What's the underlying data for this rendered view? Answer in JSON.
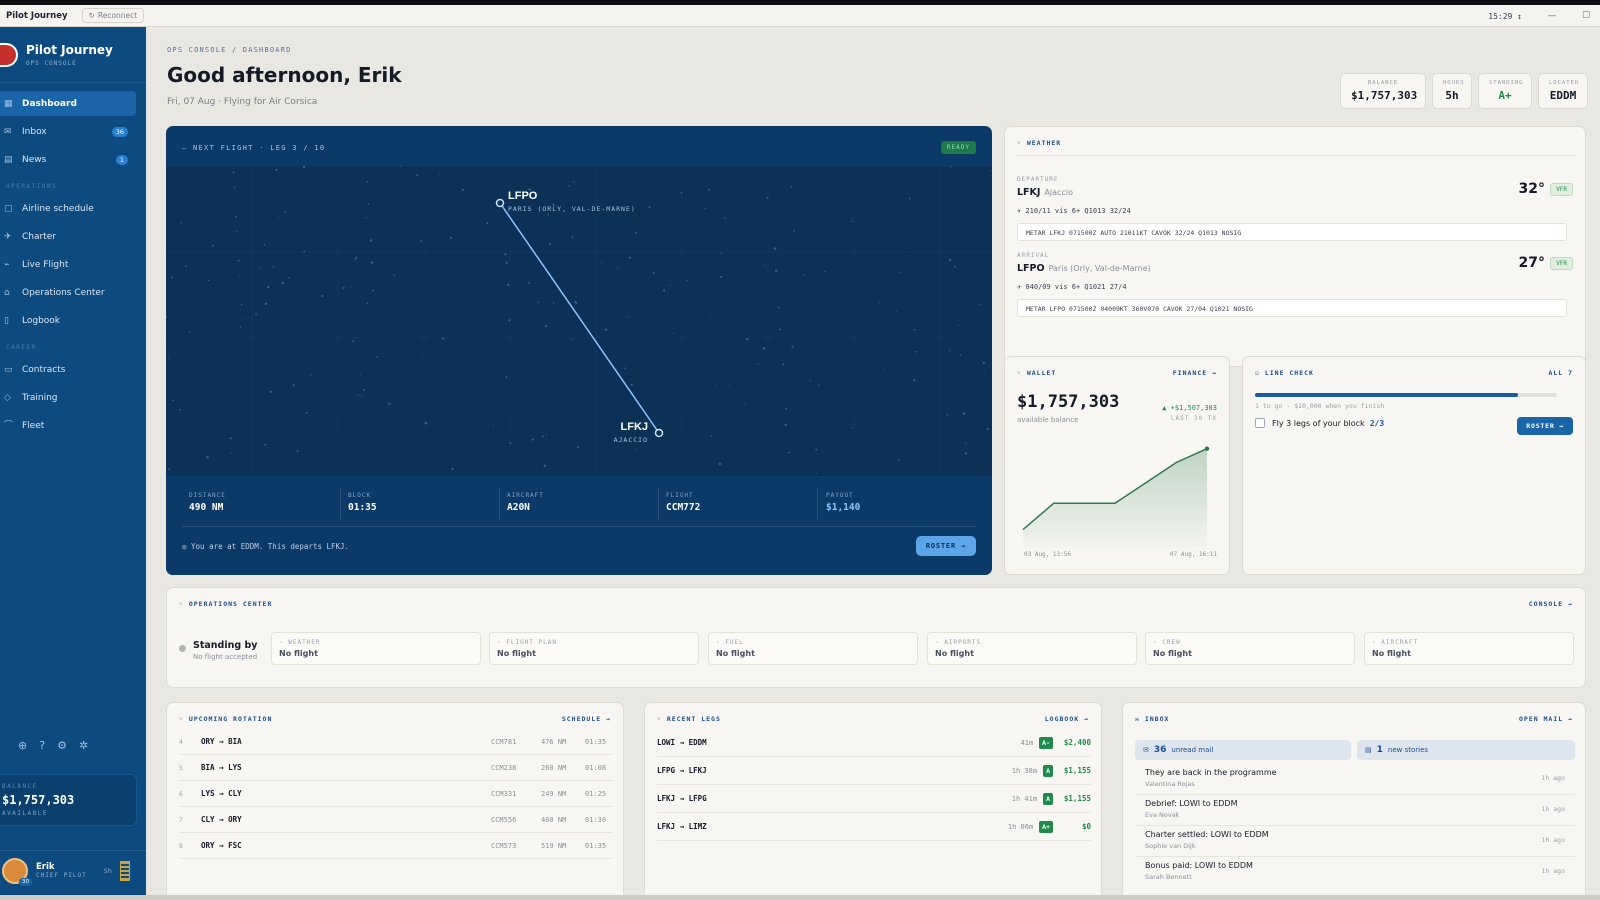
{
  "titlebar": {
    "app": "Pilot Journey",
    "reconnect": "Reconnect",
    "clock": "15:29 ↕",
    "minimize": "—",
    "maximize": "☐"
  },
  "sidebar": {
    "brand": "Pilot Journey",
    "brand_sub": "OPS CONSOLE",
    "items": [
      {
        "label": "Dashboard",
        "icon": "grid-icon",
        "active": true
      },
      {
        "label": "Inbox",
        "icon": "mail-icon",
        "badge": "36"
      },
      {
        "label": "News",
        "icon": "newspaper-icon",
        "badge": "1"
      }
    ],
    "section_ops": "OPERATIONS",
    "ops_items": [
      {
        "label": "Airline schedule",
        "icon": "calendar-icon"
      },
      {
        "label": "Charter",
        "icon": "plane-icon"
      },
      {
        "label": "Live Flight",
        "icon": "route-icon"
      },
      {
        "label": "Operations Center",
        "icon": "tower-icon"
      },
      {
        "label": "Logbook",
        "icon": "book-icon"
      }
    ],
    "section_career": "CAREER",
    "career_items": [
      {
        "label": "Contracts",
        "icon": "document-icon"
      },
      {
        "label": "Training",
        "icon": "cap-icon"
      },
      {
        "label": "Fleet",
        "icon": "hangar-icon"
      }
    ],
    "bottom_icons": [
      "globe-icon",
      "help-icon",
      "gear-icon",
      "bug-icon"
    ],
    "balance_label": "BALANCE",
    "balance": "$1,757,303",
    "balance_sub": "AVAILABLE",
    "user_name": "Erik",
    "user_role": "CHIEF PILOT",
    "user_hours": "5h",
    "user_level": "30"
  },
  "header": {
    "breadcrumb": "OPS CONSOLE / DASHBOARD",
    "greeting": "Good afternoon, Erik",
    "date": "Fri, 07 Aug · Flying for Air Corsica"
  },
  "stats": [
    {
      "label": "BALANCE",
      "value": "$1,757,303"
    },
    {
      "label": "HOURS",
      "value": "5h"
    },
    {
      "label": "STANDING",
      "value": "A+"
    },
    {
      "label": "LOCATED",
      "value": "EDDM"
    }
  ],
  "next_flight": {
    "heading": "— NEXT FLIGHT · LEG 3 / 10",
    "status": "READY",
    "origin_code": "LFPO",
    "origin_name": "PARIS (ORLY, VAL-DE-MARNE)",
    "dest_code": "LFKJ",
    "dest_name": "AJACCIO",
    "details": [
      {
        "label": "DISTANCE",
        "value": "490 NM"
      },
      {
        "label": "BLOCK",
        "value": "01:35"
      },
      {
        "label": "AIRCRAFT",
        "value": "A20N"
      },
      {
        "label": "FLIGHT",
        "value": "CCM772"
      },
      {
        "label": "PAYOUT",
        "value": "$1,140"
      }
    ],
    "note": "You are at EDDM. This departs LFKJ.",
    "roster": "ROSTER →"
  },
  "weather": {
    "heading": "WEATHER",
    "departure_label": "DEPARTURE",
    "dep_icao": "LFKJ",
    "dep_city": "Ajaccio",
    "dep_temp": "32°",
    "dep_rule": "VFR",
    "dep_wind": "✈ 210/11  vis 6+  Q1013  32/24",
    "dep_metar": "METAR LFKJ 071500Z AUTO 21011KT CAVOK 32/24 Q1013 NOSIG",
    "arrival_label": "ARRIVAL",
    "arr_icao": "LFPO",
    "arr_city": "Paris (Orly, Val-de-Marne)",
    "arr_temp": "27°",
    "arr_rule": "VFR",
    "arr_wind": "✈ 040/09  vis 6+  Q1021  27/4",
    "arr_metar": "METAR LFPO 071500Z 04009KT 360V070 CAVOK 27/04 Q1021 NOSIG"
  },
  "wallet": {
    "heading": "WALLET",
    "link": "FINANCE →",
    "balance": "$1,757,303",
    "sub": "available balance",
    "delta": "▲ +$1,507,303",
    "delta_sub": "LAST 30 TX",
    "x_start": "03 Aug, 13:56",
    "x_end": "07 Aug, 16:11",
    "accent": "#2e7a4e"
  },
  "line_check": {
    "heading": "LINE CHECK",
    "link": "ALL 7",
    "progress": 0.87,
    "note": "1 to go · $10,000 when you finish",
    "task": "Fly 3 legs of your block",
    "task_count": "2/3",
    "button": "ROSTER →"
  },
  "ops_center": {
    "heading": "OPERATIONS CENTER",
    "link": "CONSOLE →",
    "status": "Standing by",
    "status_sub": "No flight accepted",
    "boxes": [
      {
        "label": "WEATHER",
        "value": "No flight"
      },
      {
        "label": "FLIGHT PLAN",
        "value": "No flight"
      },
      {
        "label": "FUEL",
        "value": "No flight"
      },
      {
        "label": "AIRPORTS",
        "value": "No flight"
      },
      {
        "label": "CREW",
        "value": "No flight"
      },
      {
        "label": "AIRCRAFT",
        "value": "No flight"
      }
    ]
  },
  "rotation": {
    "heading": "UPCOMING ROTATION",
    "link": "SCHEDULE →",
    "rows": [
      {
        "n": "4",
        "route": "ORY → BIA",
        "flight": "CCM781",
        "nm": "476 NM",
        "block": "01:35"
      },
      {
        "n": "5",
        "route": "BIA → LYS",
        "flight": "CCM238",
        "nm": "260 NM",
        "block": "01:08"
      },
      {
        "n": "6",
        "route": "LYS → CLY",
        "flight": "CCM331",
        "nm": "249 NM",
        "block": "01:25"
      },
      {
        "n": "7",
        "route": "CLY → ORY",
        "flight": "CCM556",
        "nm": "460 NM",
        "block": "01:30"
      },
      {
        "n": "8",
        "route": "ORY → FSC",
        "flight": "CCM573",
        "nm": "519 NM",
        "block": "01:35"
      }
    ]
  },
  "recent_legs": {
    "heading": "RECENT LEGS",
    "link": "LOGBOOK →",
    "rows": [
      {
        "route": "LOWI → EDDM",
        "dur": "41m",
        "grade": "A-",
        "pay": "$2,400"
      },
      {
        "route": "LFPG → LFKJ",
        "dur": "1h 38m",
        "grade": "A",
        "pay": "$1,155"
      },
      {
        "route": "LFKJ → LFPG",
        "dur": "1h 41m",
        "grade": "A",
        "pay": "$1,155"
      },
      {
        "route": "LFKJ → LIMZ",
        "dur": "1h 06m",
        "grade": "A+",
        "pay": "$0"
      }
    ]
  },
  "inbox": {
    "heading": "INBOX",
    "link": "OPEN MAIL →",
    "unread_count": "36",
    "unread_label": "unread mail",
    "stories_count": "1",
    "stories_label": "new stories",
    "rows": [
      {
        "title": "They are back in the programme",
        "from": "Valentina Rojas",
        "ago": "1h ago"
      },
      {
        "title": "Debrief: LOWI to EDDM",
        "from": "Eva Novak",
        "ago": "1h ago"
      },
      {
        "title": "Charter settled: LOWI to EDDM",
        "from": "Sophie van Dijk",
        "ago": "1h ago"
      },
      {
        "title": "Bonus paid: LOWI to EDDM",
        "from": "Sarah Bennett",
        "ago": "1h ago"
      }
    ]
  },
  "chart_data": {
    "type": "area",
    "x": [
      "03 Aug, 13:56",
      "",
      "",
      "",
      "",
      "",
      "07 Aug, 16:11"
    ],
    "values": [
      250000,
      740000,
      740000,
      740000,
      1120000,
      1500000,
      1757303
    ],
    "ylim": [
      0,
      1900000
    ],
    "grid": false
  }
}
